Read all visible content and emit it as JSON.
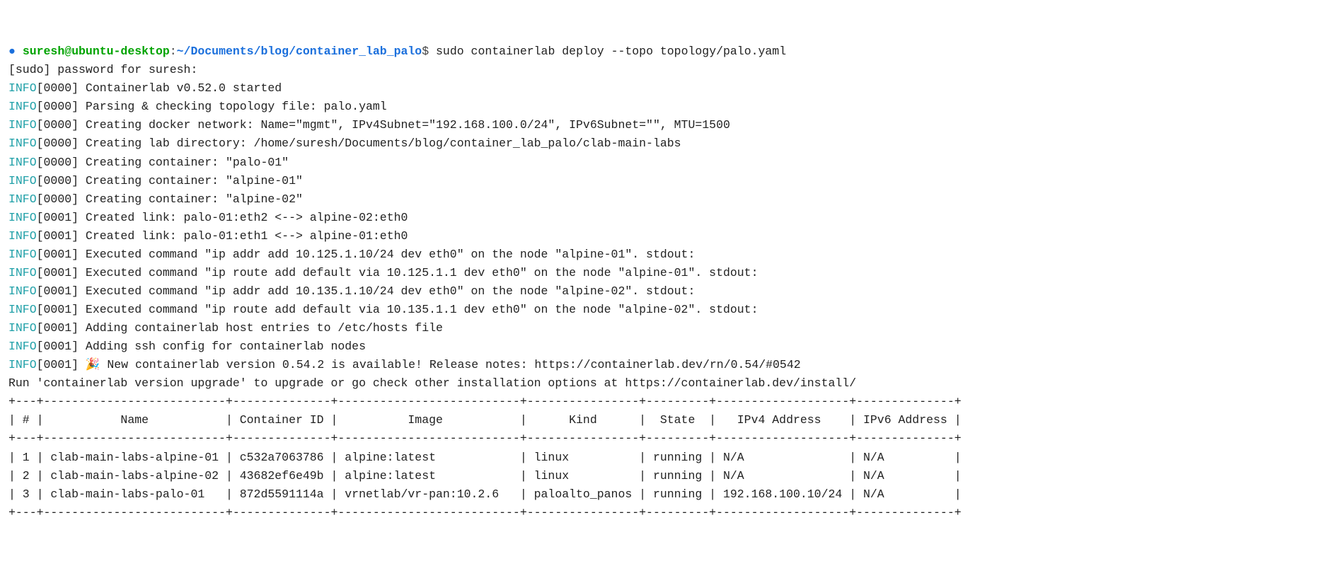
{
  "prompt": {
    "bullet": "● ",
    "userhost": "suresh@ubuntu-desktop",
    "sep1": ":",
    "path": "~/Documents/blog/container_lab_palo",
    "dollar": "$ ",
    "command": "sudo containerlab deploy --topo topology/palo.yaml"
  },
  "lines": {
    "sudo_prompt": "[sudo] password for suresh:",
    "l01": "[0000] Containerlab v0.52.0 started",
    "l02": "[0000] Parsing & checking topology file: palo.yaml",
    "l03": "[0000] Creating docker network: Name=\"mgmt\", IPv4Subnet=\"192.168.100.0/24\", IPv6Subnet=\"\", MTU=1500",
    "l04": "[0000] Creating lab directory: /home/suresh/Documents/blog/container_lab_palo/clab-main-labs",
    "l05": "[0000] Creating container: \"palo-01\"",
    "l06": "[0000] Creating container: \"alpine-01\"",
    "l07": "[0000] Creating container: \"alpine-02\"",
    "l08": "[0001] Created link: palo-01:eth2 <--> alpine-02:eth0",
    "l09": "[0001] Created link: palo-01:eth1 <--> alpine-01:eth0",
    "l10": "[0001] Executed command \"ip addr add 10.125.1.10/24 dev eth0\" on the node \"alpine-01\". stdout:",
    "l11": "[0001] Executed command \"ip route add default via 10.125.1.1 dev eth0\" on the node \"alpine-01\". stdout:",
    "l12": "[0001] Executed command \"ip addr add 10.135.1.10/24 dev eth0\" on the node \"alpine-02\". stdout:",
    "l13": "[0001] Executed command \"ip route add default via 10.135.1.1 dev eth0\" on the node \"alpine-02\". stdout:",
    "l14": "[0001] Adding containerlab host entries to /etc/hosts file",
    "l15": "[0001] Adding ssh config for containerlab nodes",
    "l16a": "[0001] ",
    "l16emoji": "🎉",
    "l16b": " New containerlab version 0.54.2 is available! Release notes: https://containerlab.dev/rn/0.54/#0542",
    "l17": "Run 'containerlab version upgrade' to upgrade or go check other installation options at https://containerlab.dev/install/"
  },
  "info_label": "INFO",
  "table": {
    "border_top": "+---+--------------------------+--------------+--------------------------+----------------+---------+-------------------+--------------+",
    "header": "| # |           Name           | Container ID |          Image           |      Kind      |  State  |   IPv4 Address    | IPv6 Address |",
    "border_mid": "+---+--------------------------+--------------+--------------------------+----------------+---------+-------------------+--------------+",
    "rows": [
      "| 1 | clab-main-labs-alpine-01 | c532a7063786 | alpine:latest            | linux          | running | N/A               | N/A          |",
      "| 2 | clab-main-labs-alpine-02 | 43682ef6e49b | alpine:latest            | linux          | running | N/A               | N/A          |",
      "| 3 | clab-main-labs-palo-01   | 872d5591114a | vrnetlab/vr-pan:10.2.6   | paloalto_panos | running | 192.168.100.10/24 | N/A          |"
    ],
    "border_bot": "+---+--------------------------+--------------+--------------------------+----------------+---------+-------------------+--------------+"
  }
}
